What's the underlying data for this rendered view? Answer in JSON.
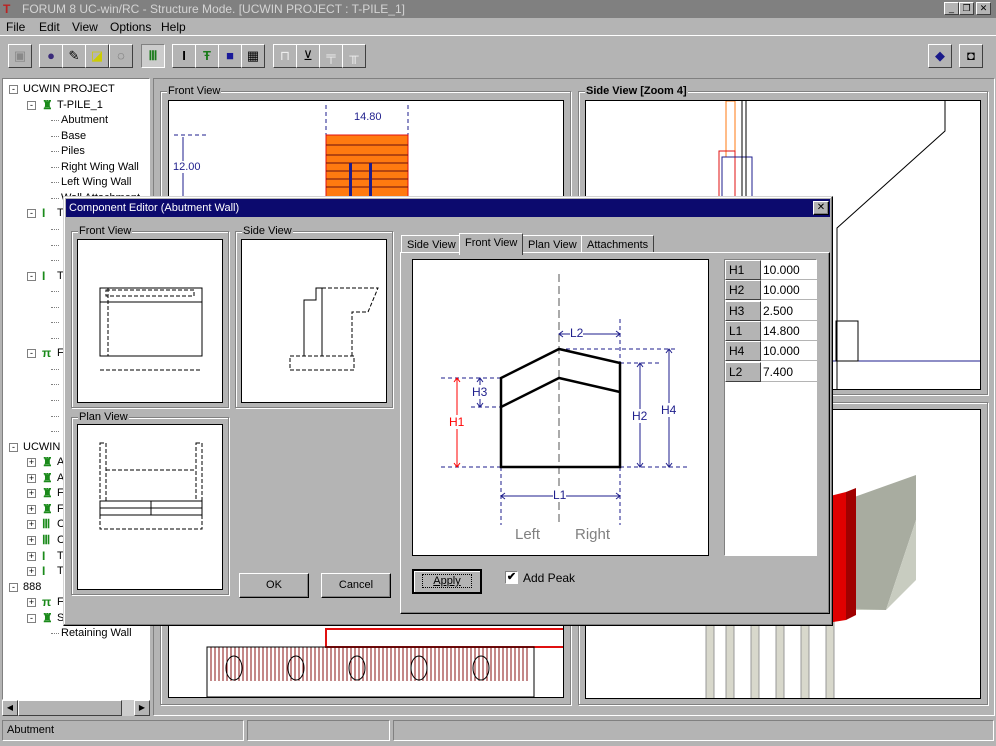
{
  "window": {
    "title": "FORUM 8   UC-win/RC - Structure Mode.   [UCWIN PROJECT : T-PILE_1]",
    "controls": [
      "_",
      "❐",
      "✕"
    ]
  },
  "menu": [
    "File",
    "Edit",
    "View",
    "Options",
    "Help"
  ],
  "toolbar": {
    "icons": [
      "save-icon",
      "globe-icon",
      "edit-document-icon",
      "new-document-icon",
      "dotted-circle-icon",
      "piles-icon",
      "i-beam-icon",
      "i-beam-color-icon",
      "truck-icon",
      "grid-table-icon",
      "abutment-icon",
      "wing-icon",
      "pier-icon",
      "pier-piles-icon",
      "book-icon",
      "camera-icon"
    ]
  },
  "tree": {
    "rows": [
      {
        "label": "UCWIN PROJECT",
        "level": 0,
        "toggle": "−"
      },
      {
        "label": "T-PILE_1",
        "level": 1,
        "toggle": "−",
        "icon": "♜"
      },
      {
        "label": "Abutment",
        "level": 2
      },
      {
        "label": "Base",
        "level": 2
      },
      {
        "label": "Piles",
        "level": 2
      },
      {
        "label": "Right Wing Wall",
        "level": 2
      },
      {
        "label": "Left Wing Wall",
        "level": 2
      },
      {
        "label": "Wall Attachment",
        "level": 2
      },
      {
        "label": "T",
        "level": 1,
        "toggle": "−",
        "icon": "I"
      },
      {
        "label": "",
        "level": 2
      },
      {
        "label": "",
        "level": 2
      },
      {
        "label": "",
        "level": 2
      },
      {
        "label": "T",
        "level": 1,
        "toggle": "−",
        "icon": "I"
      },
      {
        "label": "",
        "level": 2
      },
      {
        "label": "",
        "level": 2
      },
      {
        "label": "",
        "level": 2
      },
      {
        "label": "",
        "level": 2
      },
      {
        "label": "F",
        "level": 1,
        "toggle": "−",
        "icon": "π"
      },
      {
        "label": "",
        "level": 2
      },
      {
        "label": "",
        "level": 2
      },
      {
        "label": "",
        "level": 2
      },
      {
        "label": "",
        "level": 2
      },
      {
        "label": "",
        "level": 2
      },
      {
        "label": "UCWIN",
        "level": 0,
        "toggle": "−"
      },
      {
        "label": "A",
        "level": 1,
        "toggle": "+",
        "icon": "♜"
      },
      {
        "label": "A",
        "level": 1,
        "toggle": "+",
        "icon": "♜"
      },
      {
        "label": "F",
        "level": 1,
        "toggle": "+",
        "icon": "♜"
      },
      {
        "label": "F",
        "level": 1,
        "toggle": "+",
        "icon": "♜"
      },
      {
        "label": "C",
        "level": 1,
        "toggle": "+",
        "icon": "Ⅲ"
      },
      {
        "label": "C",
        "level": 1,
        "toggle": "+",
        "icon": "Ⅲ"
      },
      {
        "label": "T",
        "level": 1,
        "toggle": "+",
        "icon": "I"
      },
      {
        "label": "T",
        "level": 1,
        "toggle": "+",
        "icon": "I"
      },
      {
        "label": "888",
        "level": 0,
        "toggle": "−"
      },
      {
        "label": "F",
        "level": 1,
        "toggle": "+",
        "icon": "π"
      },
      {
        "label": "S",
        "level": 1,
        "toggle": "−",
        "icon": "♜"
      },
      {
        "label": "Retaining Wall",
        "level": 2
      }
    ]
  },
  "views": {
    "front": {
      "label": "Front View",
      "dim_width": "14.80",
      "dim_height": "12.00"
    },
    "side": {
      "label": "Side View   [Zoom 4]"
    }
  },
  "status": {
    "panel1": "Abutment",
    "panel2": "",
    "panel3": ""
  },
  "dialog": {
    "title": "Component Editor (Abutment Wall)",
    "front_view_label": "Front View",
    "side_view_label": "Side View",
    "plan_view_label": "Plan View",
    "ok": "OK",
    "cancel": "Cancel",
    "tabs": [
      {
        "label": "Side View",
        "active": false
      },
      {
        "label": "Front View",
        "active": true
      },
      {
        "label": "Plan View",
        "active": false
      },
      {
        "label": "Attachments",
        "active": false
      }
    ],
    "drawing": {
      "labels": {
        "L1": "L1",
        "L2": "L2",
        "H1": "H1",
        "H2": "H2",
        "H3": "H3",
        "H4": "H4"
      },
      "left": "Left",
      "right": "Right",
      "highlight_color": "#ff0000",
      "dim_color": "#1e1e8c"
    },
    "params": [
      {
        "name": "H1",
        "value": "10.000"
      },
      {
        "name": "H2",
        "value": "10.000"
      },
      {
        "name": "H3",
        "value": "2.500"
      },
      {
        "name": "L1",
        "value": "14.800"
      },
      {
        "name": "H4",
        "value": "10.000"
      },
      {
        "name": "L2",
        "value": "7.400"
      }
    ],
    "apply": "Apply",
    "add_peak": {
      "label": "Add Peak",
      "checked": true
    }
  }
}
